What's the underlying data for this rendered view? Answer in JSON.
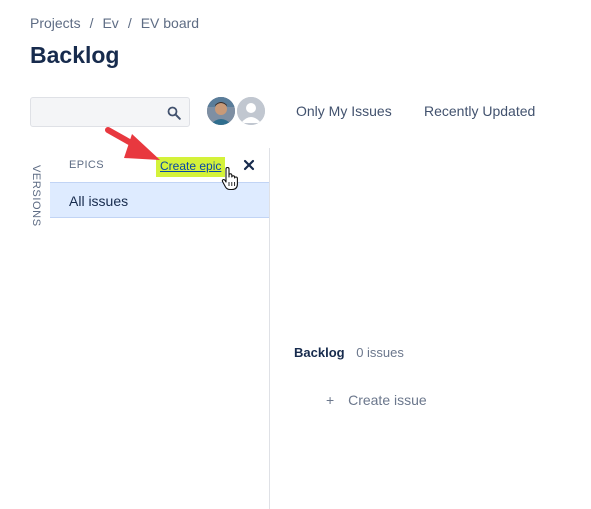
{
  "breadcrumb": {
    "items": [
      "Projects",
      "Ev",
      "EV board"
    ],
    "separator": "/"
  },
  "page": {
    "title": "Backlog"
  },
  "search": {
    "value": "",
    "placeholder": ""
  },
  "quick_filters": {
    "only_my_issues": "Only My Issues",
    "recently_updated": "Recently Updated"
  },
  "versions_tab": {
    "label": "VERSIONS"
  },
  "epics_panel": {
    "title": "EPICS",
    "create_epic": "Create epic",
    "all_issues": "All issues"
  },
  "backlog": {
    "name": "Backlog",
    "count_text": "0 issues",
    "create_issue_plus": "+",
    "create_issue": "Create issue"
  },
  "colors": {
    "highlight": "#d4f23a",
    "selected_row": "#deebff",
    "annotation_arrow": "#e8383f",
    "text_primary": "#172b4d",
    "text_secondary": "#5e6c84"
  },
  "icons": {
    "search": "search-icon",
    "close": "close-icon",
    "cursor": "hand-pointer-icon",
    "arrow": "red-arrow-annotation"
  }
}
